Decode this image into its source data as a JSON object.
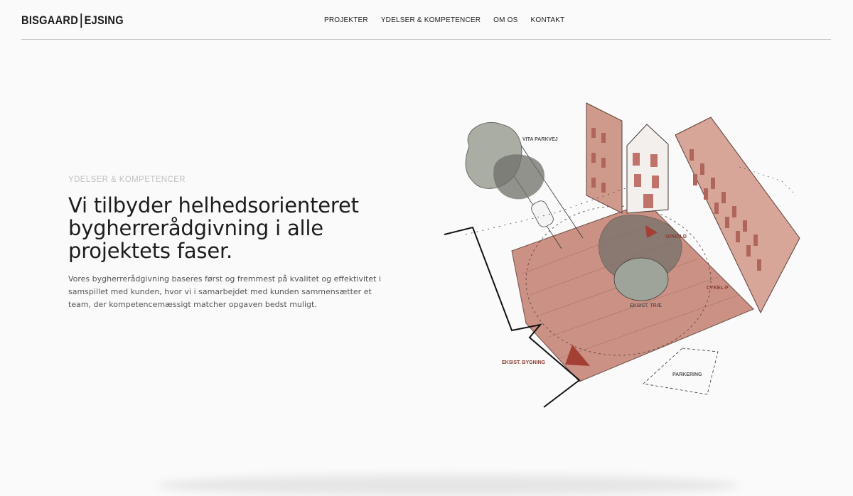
{
  "header": {
    "logo_left": "BISGAARD",
    "logo_right": "EJSING",
    "nav": [
      {
        "label": "PROJEKTER"
      },
      {
        "label": "YDELSER & KOMPETENCER"
      },
      {
        "label": "OM OS"
      },
      {
        "label": "KONTAKT"
      }
    ]
  },
  "hero": {
    "eyebrow": "YDELSER & KOMPETENCER",
    "headline": "Vi tilbyder helhedsorienteret bygherrerådgivning i alle projektets faser.",
    "body": "Vores bygherrerådgivning baseres først og fremmest på kvalitet og effektivitet i samspillet med kunden, hvor vi i samarbejdet med kunden sammensætter et team, der kompetencemæssigt matcher opgaven bedst muligt."
  },
  "illustration": {
    "labels": {
      "road": "VITA PARKVEJ",
      "stay": "OPHOLD",
      "bike": "CYKEL-P",
      "tree": "EKSIST. TRÆ",
      "existing_building": "EKSIST. BYGNING",
      "parking": "PARKERING"
    },
    "colors": {
      "plaza": "#c98c7e",
      "brick": "#c07a68",
      "shadow": "#6f6f68",
      "tree": "#9ea49a",
      "label_dark": "#555555",
      "label_red": "#8a3b30"
    }
  }
}
